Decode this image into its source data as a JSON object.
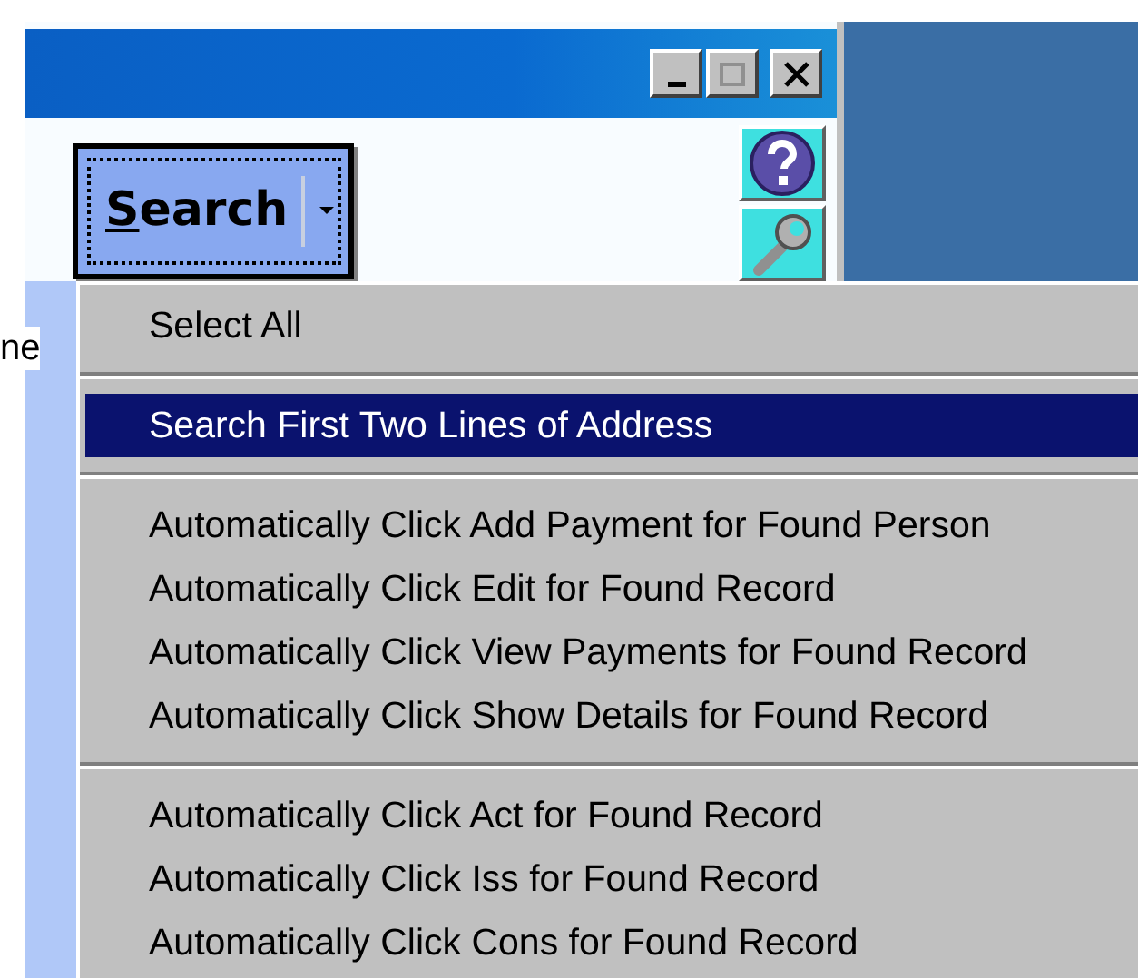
{
  "search_button": {
    "label": "Search",
    "focused": true
  },
  "behind_text": "ne",
  "menu": {
    "items": [
      {
        "kind": "item",
        "label": "Select All",
        "selected": false
      },
      {
        "kind": "separator"
      },
      {
        "kind": "item",
        "label": "Search First Two Lines of Address",
        "selected": true
      },
      {
        "kind": "separator"
      },
      {
        "kind": "item",
        "label": "Automatically Click Add Payment for Found Person",
        "selected": false
      },
      {
        "kind": "item",
        "label": "Automatically Click Edit for Found Record",
        "selected": false
      },
      {
        "kind": "item",
        "label": "Automatically Click View Payments for Found Record",
        "selected": false
      },
      {
        "kind": "item",
        "label": "Automatically Click Show Details for Found Record",
        "selected": false
      },
      {
        "kind": "separator"
      },
      {
        "kind": "item",
        "label": "Automatically Click Act for Found Record",
        "selected": false
      },
      {
        "kind": "item",
        "label": "Automatically Click Iss for Found Record",
        "selected": false
      },
      {
        "kind": "item",
        "label": "Automatically Click Cons for Found Record",
        "selected": false
      }
    ]
  }
}
